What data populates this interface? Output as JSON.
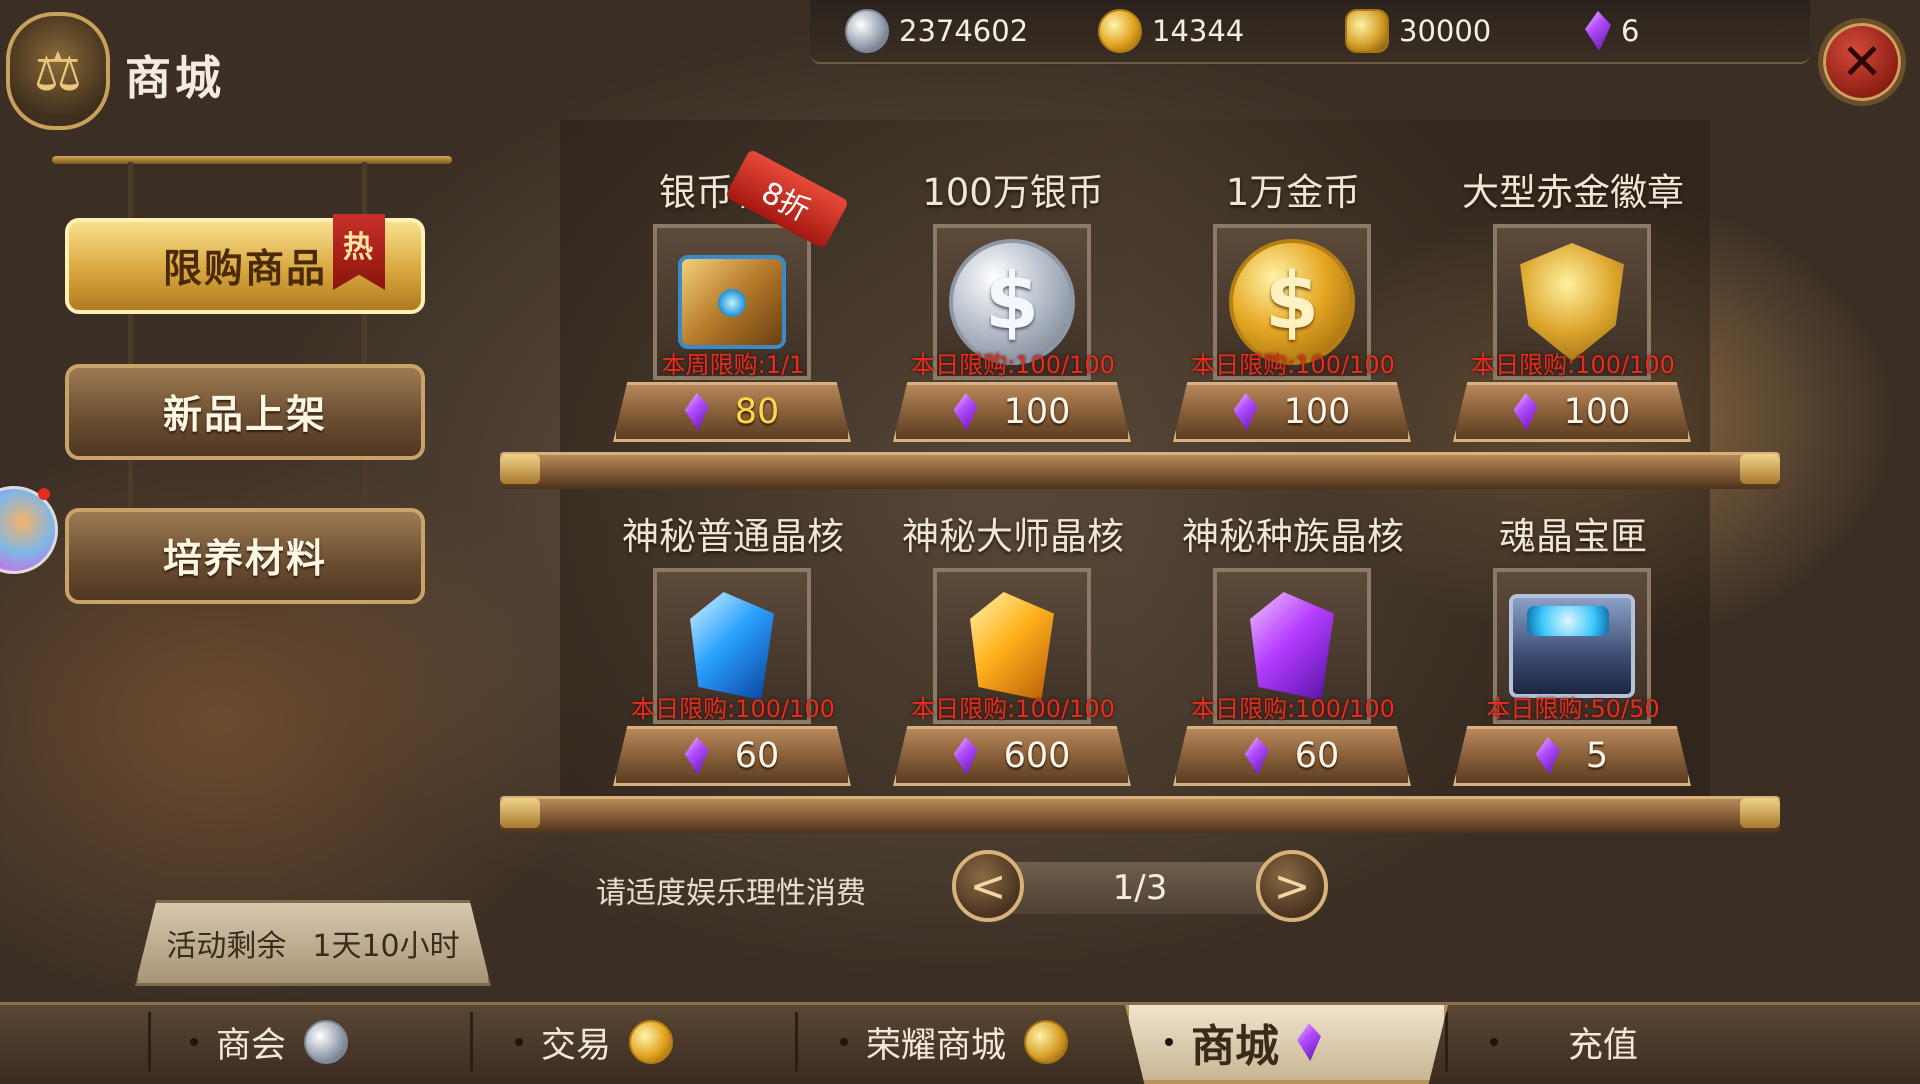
{
  "header": {
    "title": "商城"
  },
  "currencies": [
    {
      "icon": "silver-coin-icon",
      "value": "2374602"
    },
    {
      "icon": "gold-coin-icon",
      "value": "14344"
    },
    {
      "icon": "honor-badge-icon",
      "value": "30000"
    },
    {
      "icon": "purple-crystal-icon",
      "value": "6"
    }
  ],
  "menu": [
    {
      "label": "限购商品",
      "tag": "热",
      "active": true
    },
    {
      "label": "新品上架"
    },
    {
      "label": "培养材料"
    }
  ],
  "timer": {
    "label": "活动剩余",
    "value": "1天10小时"
  },
  "shelf_1": [
    {
      "name": "银币礼箱",
      "limit": "本周限购:1/1",
      "price": "80",
      "sale": "8折"
    },
    {
      "name": "100万银币",
      "limit": "本日限购:100/100",
      "price": "100"
    },
    {
      "name": "1万金币",
      "limit": "本日限购:100/100",
      "price": "100"
    },
    {
      "name": "大型赤金徽章",
      "limit": "本日限购:100/100",
      "price": "100"
    }
  ],
  "shelf_2": [
    {
      "name": "神秘普通晶核",
      "limit": "本日限购:100/100",
      "price": "60"
    },
    {
      "name": "神秘大师晶核",
      "limit": "本日限购:100/100",
      "price": "600"
    },
    {
      "name": "神秘种族晶核",
      "limit": "本日限购:100/100",
      "price": "60"
    },
    {
      "name": "魂晶宝匣",
      "limit": "本日限购:50/50",
      "price": "5"
    }
  ],
  "pager": {
    "notice": "请适度娱乐理性消费",
    "indicator": "1/3",
    "prev": "<",
    "next": ">"
  },
  "bottom_nav": [
    {
      "label": "商会"
    },
    {
      "label": "交易"
    },
    {
      "label": "荣耀商城"
    },
    {
      "label": "商城",
      "active": true
    },
    {
      "label": "充值"
    }
  ],
  "colors": {
    "limit_text": "#e82d1e",
    "price_highlight": "#ffd84a",
    "active_menu": "#d9a73e"
  }
}
